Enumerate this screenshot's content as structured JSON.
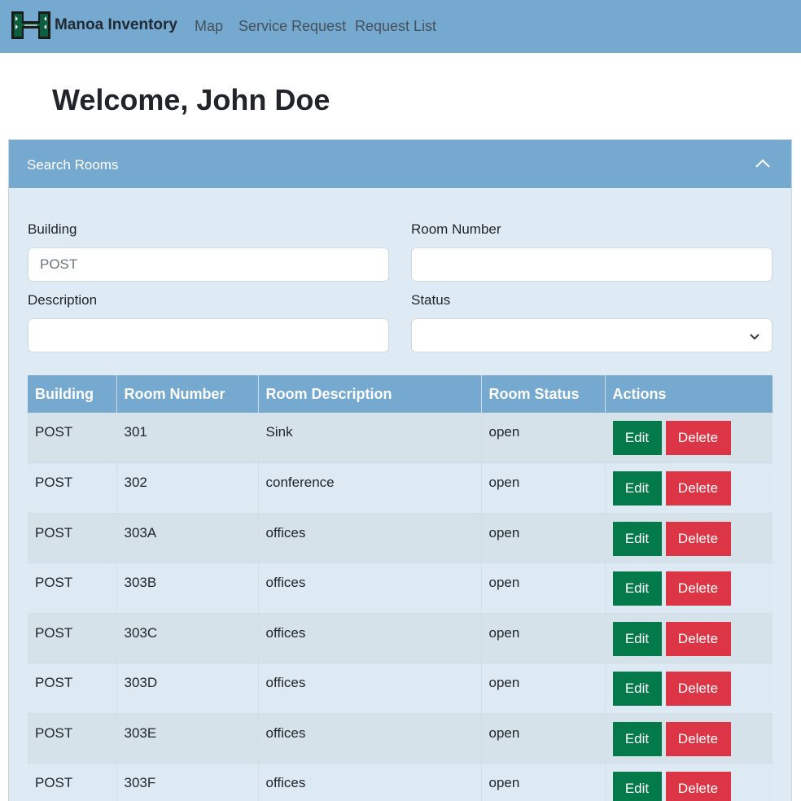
{
  "navbar": {
    "brand": "Manoa Inventory",
    "links": [
      "Map",
      "Service Request",
      "Request List"
    ]
  },
  "welcome": "Welcome, John Doe",
  "search": {
    "title": "Search Rooms",
    "toggle_icon": "chevron-up-icon",
    "building_label": "Building",
    "building_value": "",
    "building_placeholder": "POST",
    "room_number_label": "Room Number",
    "room_number_value": "",
    "description_label": "Description",
    "description_value": "",
    "status_label": "Status",
    "status_value": ""
  },
  "table": {
    "columns": [
      "Building",
      "Room Number",
      "Room Description",
      "Room Status",
      "Actions"
    ],
    "rows": [
      {
        "building": "POST",
        "room": "301",
        "description": "Sink",
        "status": "open"
      },
      {
        "building": "POST",
        "room": "302",
        "description": "conference",
        "status": "open"
      },
      {
        "building": "POST",
        "room": "303A",
        "description": "offices",
        "status": "open"
      },
      {
        "building": "POST",
        "room": "303B",
        "description": "offices",
        "status": "open"
      },
      {
        "building": "POST",
        "room": "303C",
        "description": "offices",
        "status": "open"
      },
      {
        "building": "POST",
        "room": "303D",
        "description": "offices",
        "status": "open"
      },
      {
        "building": "POST",
        "room": "303E",
        "description": "offices",
        "status": "open"
      },
      {
        "building": "POST",
        "room": "303F",
        "description": "offices",
        "status": "open"
      }
    ],
    "edit_label": "Edit",
    "delete_label": "Delete"
  },
  "colors": {
    "navbar": "#76a9cf",
    "panel": "#dfebf4",
    "edit": "#04794a",
    "delete": "#dc3545",
    "logo": "#0b5f3e"
  }
}
